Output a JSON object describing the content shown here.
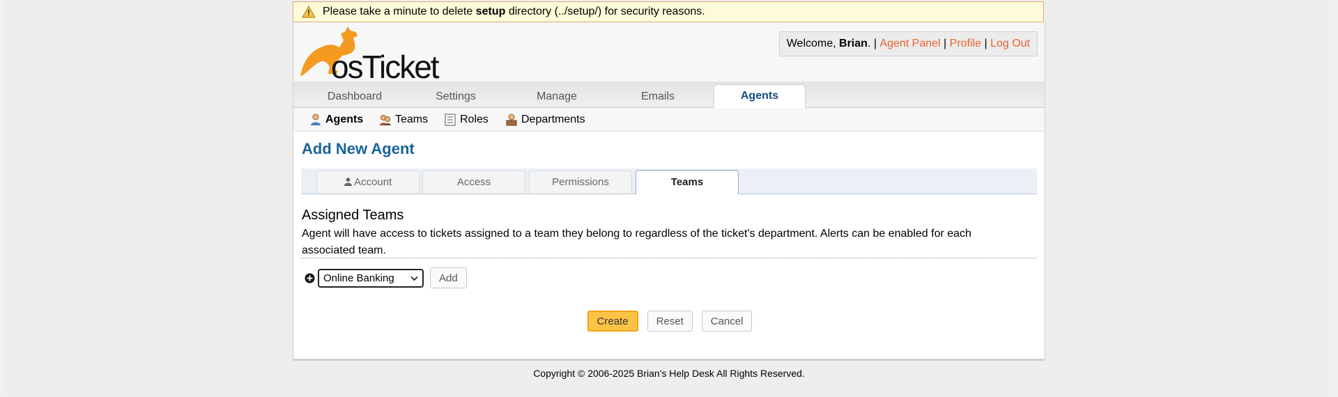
{
  "warning": {
    "prefix": "Please take a minute to delete ",
    "bold": "setup",
    "suffix": " directory (../setup/) for security reasons."
  },
  "header": {
    "logo_alt": "osTicket",
    "welcome_prefix": "Welcome, ",
    "user_name": "Brian",
    "welcome_suffix": ". | ",
    "links": [
      "Agent Panel",
      "Profile",
      "Log Out"
    ],
    "separator": " | "
  },
  "nav": {
    "tabs": [
      "Dashboard",
      "Settings",
      "Manage",
      "Emails",
      "Agents"
    ],
    "active": "Agents"
  },
  "subnav": {
    "items": [
      "Agents",
      "Teams",
      "Roles",
      "Departments"
    ],
    "active": "Agents"
  },
  "main": {
    "title": "Add New Agent",
    "tabs": [
      "Account",
      "Access",
      "Permissions",
      "Teams"
    ],
    "active_tab": "Teams",
    "section_title": "Assigned Teams",
    "section_desc": "Agent will have access to tickets assigned to a team they belong to regardless of the ticket's department. Alerts can be enabled for each associated team.",
    "team_select_value": "Online Banking",
    "add_label": "Add",
    "buttons": {
      "create": "Create",
      "reset": "Reset",
      "cancel": "Cancel"
    }
  },
  "footer": {
    "text": "Copyright © 2006-2025 Brian's Help Desk All Rights Reserved."
  },
  "colors": {
    "accent": "#e8622c",
    "title_blue": "#18649a",
    "primary_button": "#fdc347",
    "warning_bg": "#fdfbd8"
  }
}
